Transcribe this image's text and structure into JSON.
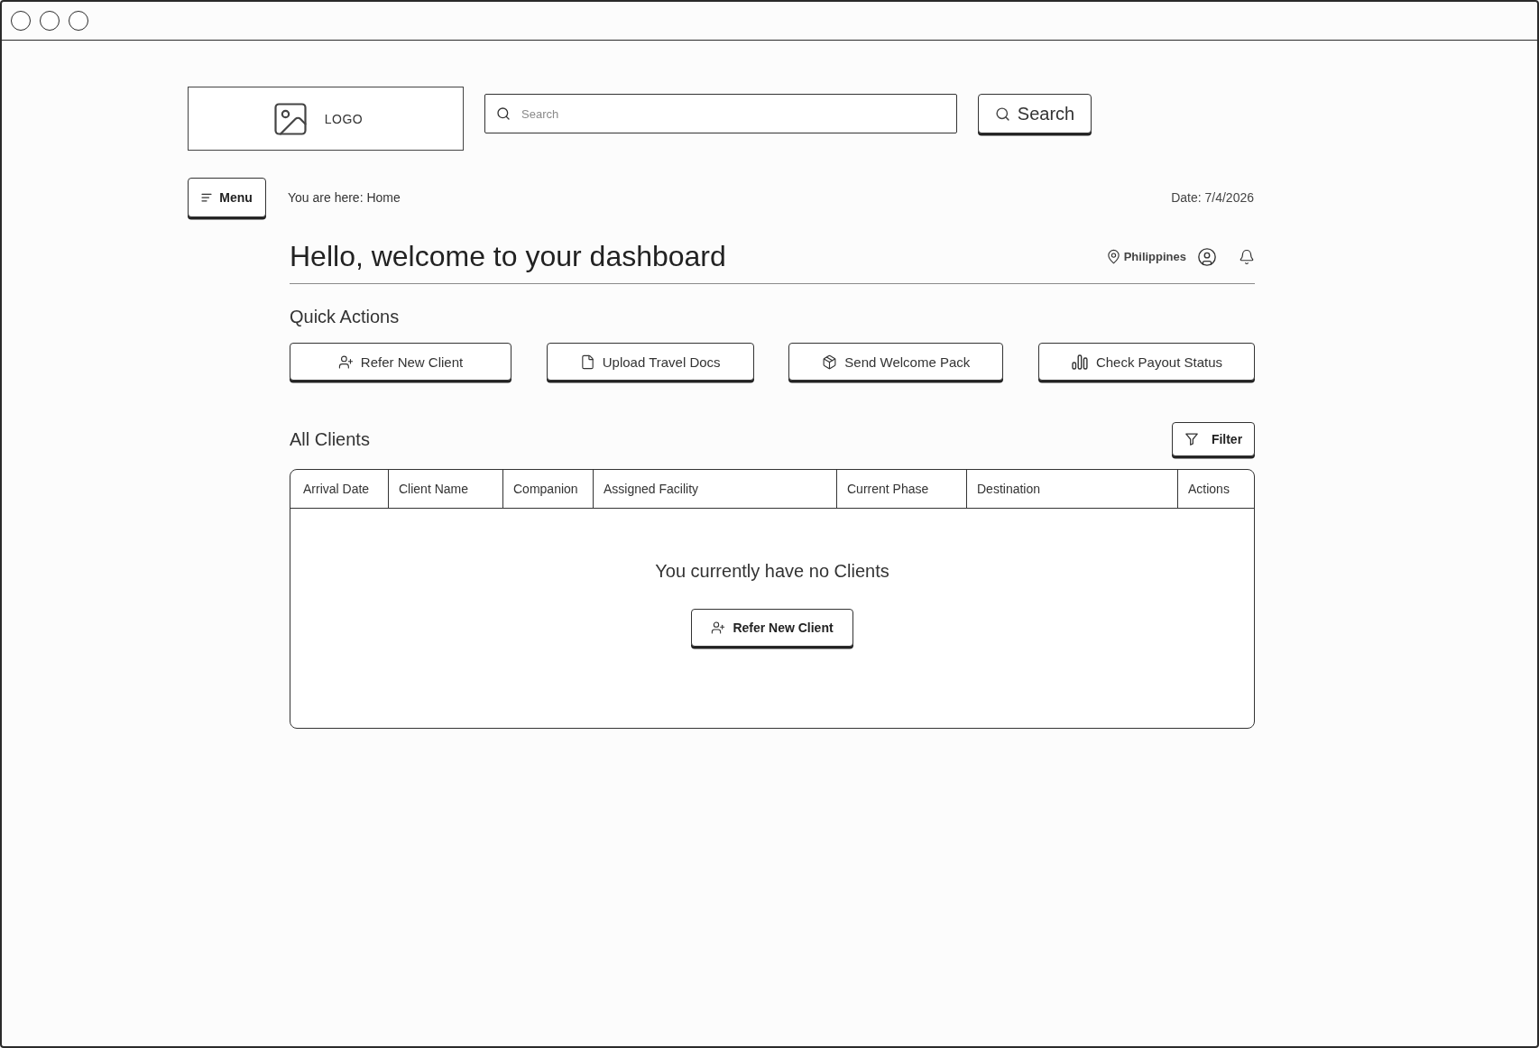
{
  "header": {
    "logo": {
      "label": "LOGO"
    },
    "search": {
      "placeholder": "Search"
    },
    "search_button": "Search"
  },
  "nav": {
    "menu_button": "Menu",
    "breadcrumb": "You are here: Home",
    "date": "Date: 7/4/2026"
  },
  "dashboard": {
    "title": "Hello, welcome to your dashboard",
    "location": "Philippines"
  },
  "quick_actions": {
    "title": "Quick Actions",
    "buttons": [
      {
        "label": "Refer New Client",
        "kind": "user-plus"
      },
      {
        "label": "Upload Travel Docs",
        "kind": "file"
      },
      {
        "label": "Send Welcome Pack",
        "kind": "package"
      },
      {
        "label": "Check Payout Status",
        "kind": "bar-chart"
      }
    ]
  },
  "clients": {
    "title": "All Clients",
    "filter_button": "Filter",
    "table": {
      "columns": [
        "Arrival Date",
        "Client Name",
        "Companion",
        "Assigned Facility",
        "Current Phase",
        "Destination",
        "Actions"
      ],
      "empty_message": "You currently have no Clients",
      "empty_action": "Refer New Client"
    }
  }
}
